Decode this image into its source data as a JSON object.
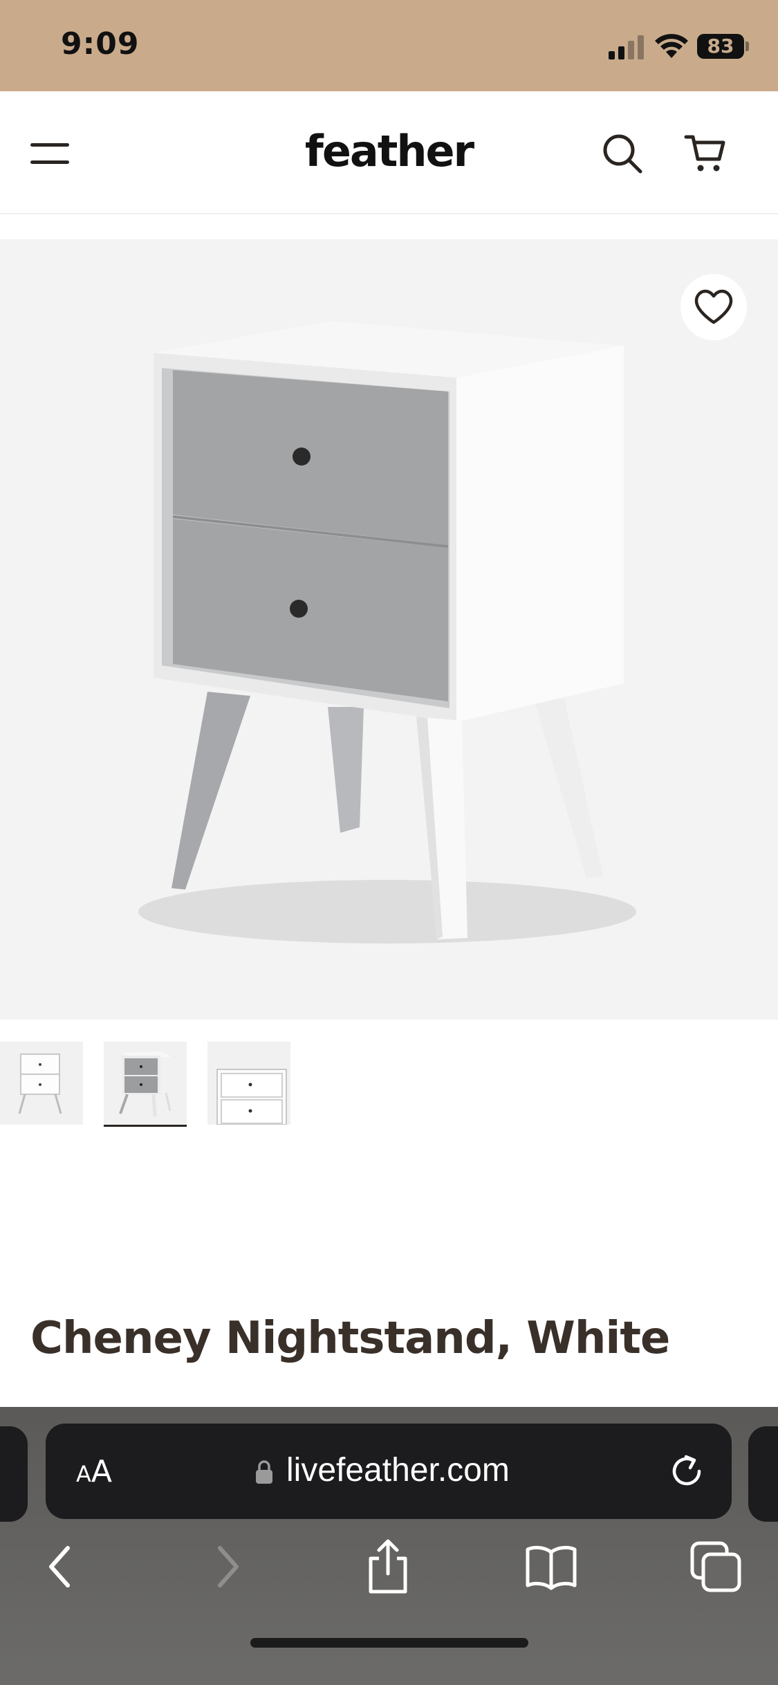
{
  "status_bar": {
    "time": "9:09",
    "battery": "83"
  },
  "header": {
    "logo": "feather",
    "icons": [
      "menu-icon",
      "search-icon",
      "cart-icon"
    ]
  },
  "product": {
    "title": "Cheney Nightstand, White",
    "favorite_icon": "heart-icon",
    "thumbnails": [
      {
        "name": "white-nightstand-front",
        "selected": false
      },
      {
        "name": "nightstand-angled",
        "selected": true
      },
      {
        "name": "nightstand-drawers-closeup",
        "selected": false
      }
    ]
  },
  "browser": {
    "aa_small": "A",
    "aa_large": "A",
    "url": "livefeather.com",
    "toolbar_icons": [
      "back-icon",
      "forward-icon",
      "share-icon",
      "bookmarks-icon",
      "tabs-icon"
    ]
  },
  "colors": {
    "status_bar_bg": "#c9ab8c",
    "image_bg": "#f3f3f3",
    "title_text": "#3a302a",
    "toolbar_bg": "#5b5a58"
  }
}
